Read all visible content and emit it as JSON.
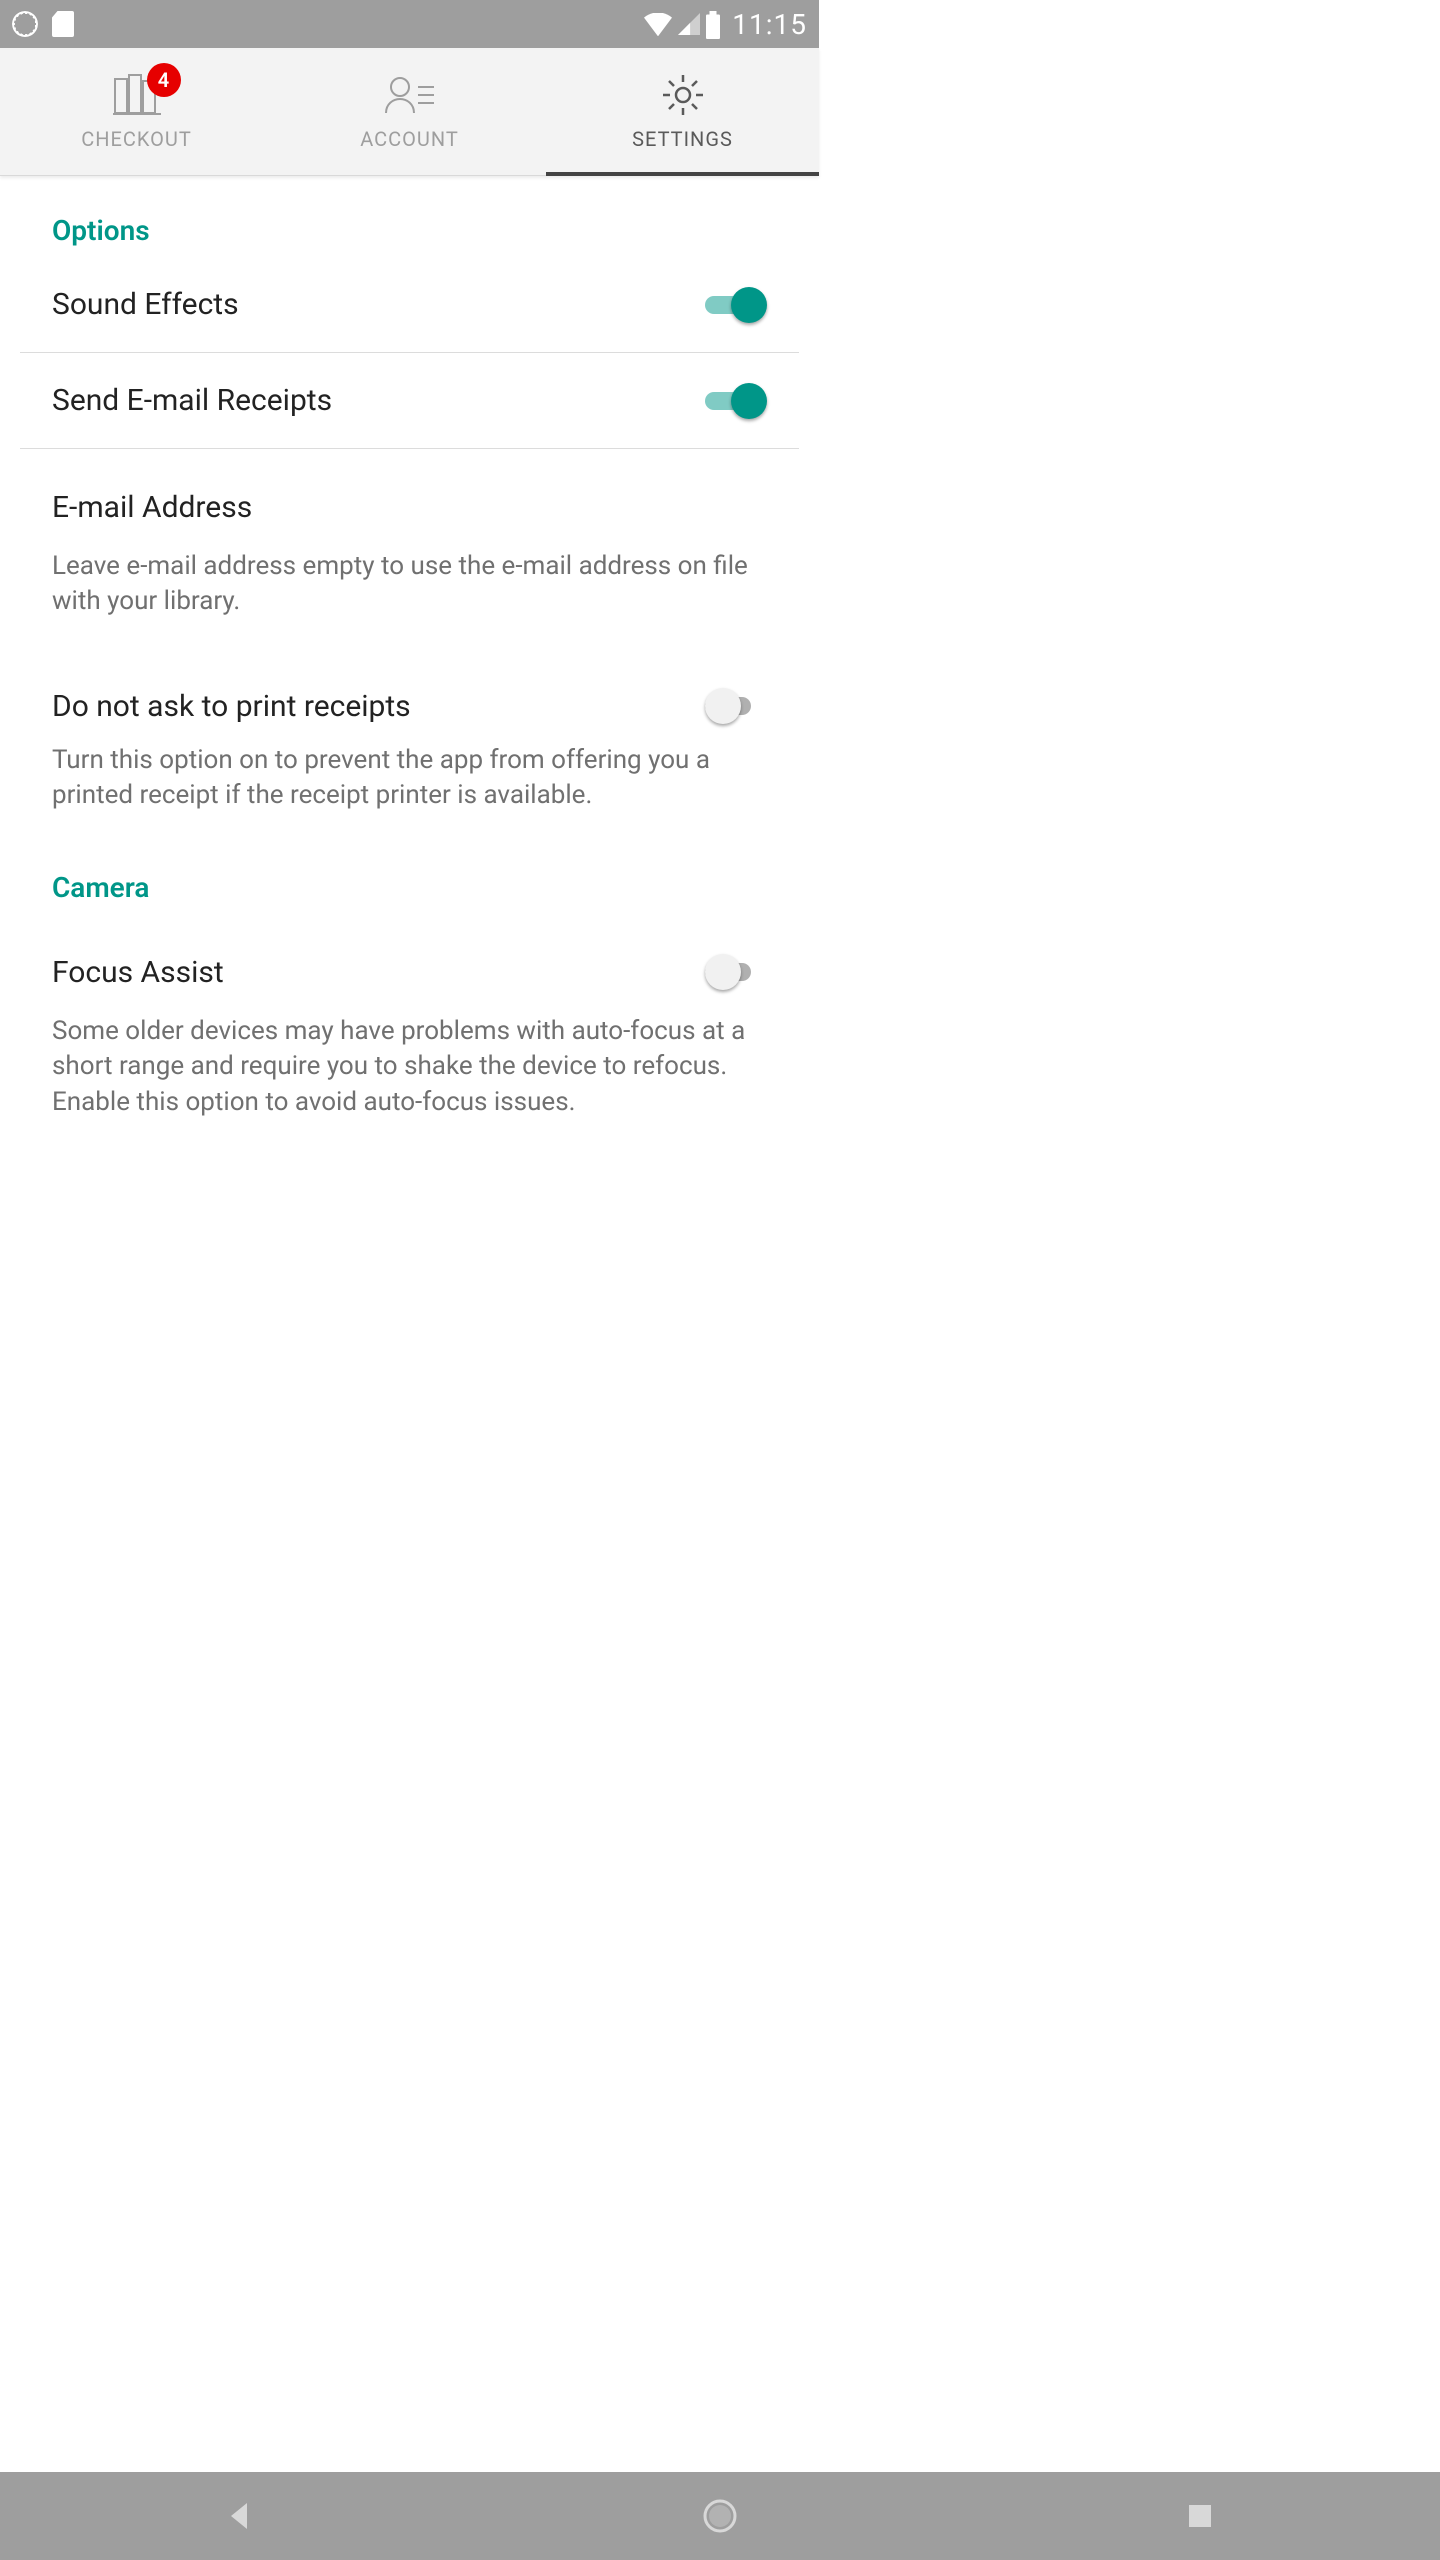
{
  "status_bar": {
    "time": "11:15"
  },
  "tabs": {
    "checkout": {
      "label": "CHECKOUT",
      "badge": "4"
    },
    "account": {
      "label": "ACCOUNT"
    },
    "settings": {
      "label": "SETTINGS"
    }
  },
  "sections": {
    "options": {
      "title": "Options",
      "sound_effects": {
        "label": "Sound Effects",
        "on": true
      },
      "send_receipts": {
        "label": "Send E-mail Receipts",
        "on": true
      },
      "email_address": {
        "label": "E-mail Address",
        "hint": "Leave e-mail address empty to use the e-mail address on file with your library."
      },
      "no_print_receipts": {
        "label": "Do not ask to print receipts",
        "on": false,
        "hint": "Turn this option on to prevent the app from offering you a printed receipt if the receipt printer is available."
      }
    },
    "camera": {
      "title": "Camera",
      "focus_assist": {
        "label": "Focus Assist",
        "on": false,
        "hint": "Some older devices may have problems with auto-focus at a short range and require you to shake the device to refocus. Enable this option to avoid auto-focus issues."
      }
    }
  }
}
